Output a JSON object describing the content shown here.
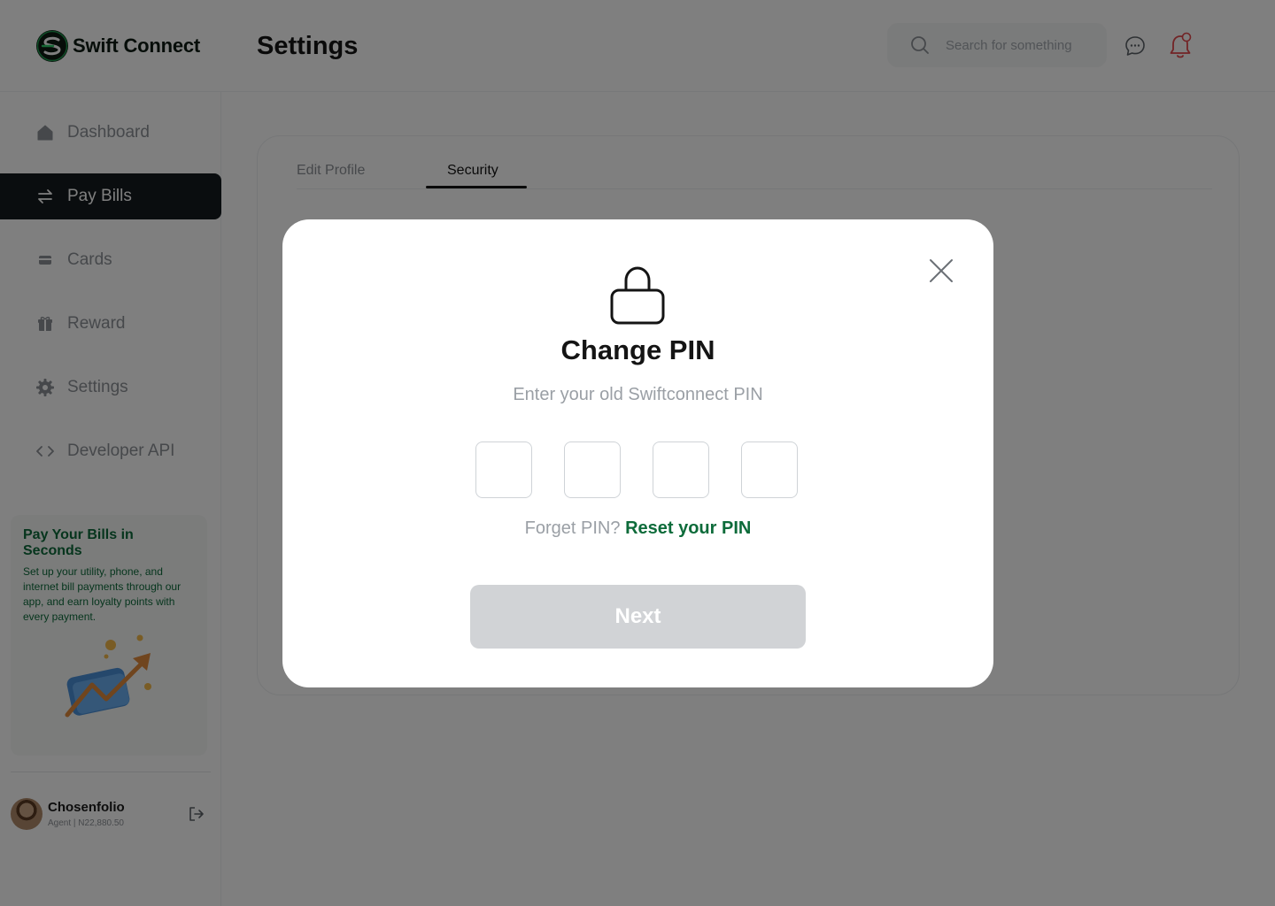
{
  "app": {
    "name": "Swift Connect",
    "page_title": "Settings"
  },
  "header": {
    "search": {
      "placeholder": "Search for something"
    },
    "icons": [
      "search-icon",
      "chat-icon",
      "bell-icon"
    ]
  },
  "sidebar": {
    "items": [
      {
        "label": "Dashboard",
        "icon": "home-icon",
        "active": false
      },
      {
        "label": "Pay Bills",
        "icon": "transfer-icon",
        "active": true
      },
      {
        "label": "Cards",
        "icon": "card-icon",
        "active": false
      },
      {
        "label": "Reward",
        "icon": "gift-icon",
        "active": false
      },
      {
        "label": "Settings",
        "icon": "gear-icon",
        "active": false
      },
      {
        "label": "Developer API",
        "icon": "code-icon",
        "active": false
      }
    ],
    "promo": {
      "title": "Pay Your Bills in Seconds",
      "text": "Set up your utility, phone, and internet bill payments through our app, and earn loyalty points with every payment."
    },
    "user": {
      "name": "Chosenfolio",
      "subtitle": "Agent | N22,880.50"
    }
  },
  "tabs": [
    {
      "label": "Edit Profile",
      "active": false
    },
    {
      "label": "Security",
      "active": true
    }
  ],
  "modal": {
    "title": "Change PIN",
    "subtitle": "Enter your old Swiftconnect PIN",
    "pin_length": 4,
    "forget_text": "Forget PIN?",
    "reset_link": "Reset your PIN",
    "next_label": "Next"
  },
  "colors": {
    "brand_green": "#0d6b3a",
    "active_nav": "#141a1e",
    "disabled_button": "#d1d3d6",
    "notification_red": "#e5484d"
  }
}
